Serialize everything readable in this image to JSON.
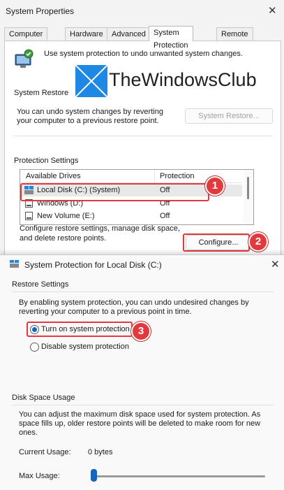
{
  "main_window": {
    "title": "System Properties",
    "tabs": [
      "Computer Name",
      "Hardware",
      "Advanced",
      "System Protection",
      "Remote"
    ],
    "intro_text": "Use system protection to undo unwanted system changes.",
    "restore_heading": "System Restore",
    "restore_desc_1": "You can undo system changes by reverting",
    "restore_desc_2": "your computer to a previous restore point.",
    "restore_button": "System Restore...",
    "protection_heading": "Protection Settings",
    "drives_header": {
      "col1": "Available Drives",
      "col2": "Protection"
    },
    "drives": [
      {
        "name": "Local Disk (C:) (System)",
        "protection": "Off"
      },
      {
        "name": "Windows (D:)",
        "protection": "Off"
      },
      {
        "name": "New Volume (E:)",
        "protection": "Off"
      }
    ],
    "configure_desc_1": "Configure restore settings, manage disk space,",
    "configure_desc_2": "and delete restore points.",
    "configure_button": "Configure..."
  },
  "watermark": {
    "text": "TheWindowsClub"
  },
  "dialog": {
    "title": "System Protection for Local Disk (C:)",
    "restore_settings_heading": "Restore Settings",
    "restore_desc_1": "By enabling system protection, you can undo undesired changes by",
    "restore_desc_2": "reverting your computer to a previous point in time.",
    "option_on": "Turn on system protection",
    "option_off": "Disable system protection",
    "disk_heading": "Disk Space Usage",
    "disk_desc_1": "You can adjust the maximum disk space used for system protection. As",
    "disk_desc_2": "space fills up, older restore points will be deleted to make room for new",
    "disk_desc_3": "ones.",
    "current_usage_label": "Current Usage:",
    "current_usage_value": "0 bytes",
    "max_usage_label": "Max Usage:",
    "max_usage_fraction": 0.0
  },
  "badges": [
    "1",
    "2",
    "3"
  ],
  "colors": {
    "badge": "#e0393e",
    "accent": "#1565c0",
    "logo_blue": "#1e88e5"
  },
  "icons": [
    "close-icon",
    "system-protection-icon",
    "drive-icon",
    "windows-logo-icon"
  ]
}
